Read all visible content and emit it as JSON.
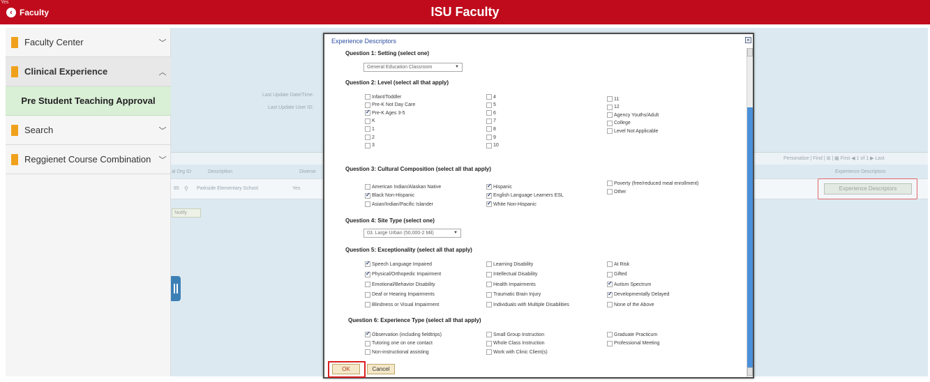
{
  "header": {
    "tag": "Yes",
    "back_label": "Faculty",
    "title": "ISU Faculty",
    "color": "#c00b1c"
  },
  "sidebar": {
    "items": [
      {
        "label": "Faculty Center",
        "chevron": "chevron-down-icon"
      },
      {
        "label": "Clinical Experience",
        "chevron": "chevron-up-icon"
      },
      {
        "label": "Pre Student Teaching Approval"
      },
      {
        "label": "Search",
        "chevron": "chevron-down-icon"
      },
      {
        "label": "Reggienet Course Combination",
        "chevron": "chevron-down-icon"
      }
    ]
  },
  "background": {
    "last_update_datetime_label": "Last Update Date/Time:",
    "last_update_user_label": "Last Update User ID:",
    "grid_toolbar": "Personalize | Find | ⊞ | ▦     First ◀ 1 of 1 ▶ Last",
    "columns": [
      "al Org ID",
      "Description",
      "Diverse",
      "Experience Descriptors"
    ],
    "row": {
      "org_id": "85",
      "description": "Parkside Elementary School",
      "diverse": "Yes"
    },
    "exp_desc_button": "Experience Descriptors",
    "notify_button": "Notify"
  },
  "modal": {
    "title": "Experience Descriptors",
    "q1": {
      "heading": "Question 1: Setting (select one)",
      "selected": "General Education Classroom"
    },
    "q2": {
      "heading": "Question 2: Level (select all that apply)",
      "col1": [
        {
          "label": "Infant/Toddler",
          "checked": false
        },
        {
          "label": "Pre-K Not Day Care",
          "checked": false
        },
        {
          "label": "Pre-K Ages 3-5",
          "checked": true
        },
        {
          "label": "K",
          "checked": false
        },
        {
          "label": "1",
          "checked": false
        },
        {
          "label": "2",
          "checked": false
        },
        {
          "label": "3",
          "checked": false
        }
      ],
      "col2": [
        {
          "label": "4",
          "checked": false
        },
        {
          "label": "5",
          "checked": false
        },
        {
          "label": "6",
          "checked": false
        },
        {
          "label": "7",
          "checked": false
        },
        {
          "label": "8",
          "checked": false
        },
        {
          "label": "9",
          "checked": false
        },
        {
          "label": "10",
          "checked": false
        }
      ],
      "col3": [
        {
          "label": "11",
          "checked": false
        },
        {
          "label": "12",
          "checked": false
        },
        {
          "label": "Agency Youths/Adult",
          "checked": false
        },
        {
          "label": "College",
          "checked": false
        },
        {
          "label": "Level Not Applicable",
          "checked": false
        }
      ]
    },
    "q3": {
      "heading": "Question 3: Cultural Composition (select all that apply)",
      "col1": [
        {
          "label": "American Indian/Alaskan Native",
          "checked": false
        },
        {
          "label": "Black Non-Hispanic",
          "checked": true
        },
        {
          "label": "Asian/Indian/Pacific Islander",
          "checked": false
        }
      ],
      "col2": [
        {
          "label": "Hispanic",
          "checked": true
        },
        {
          "label": "English Language Learners ESL",
          "checked": true
        },
        {
          "label": "White Non-Hispanic",
          "checked": true
        }
      ],
      "col3": [
        {
          "label": "Poverty (free/reduced meal enrollment)",
          "checked": false
        },
        {
          "label": "Other",
          "checked": false
        }
      ]
    },
    "q4": {
      "heading": "Question 4: Site Type (select one)",
      "selected": "03. Large Urban (50,000-2 Mil)"
    },
    "q5": {
      "heading": "Question 5: Exceptionality (select all that apply)",
      "col1": [
        {
          "label": "Speech Language Impaired",
          "checked": true
        },
        {
          "label": "Physical/Orthopedic Impairment",
          "checked": true
        },
        {
          "label": "Emotional/Behavior Disability",
          "checked": false
        },
        {
          "label": "Deaf or Hearing Impairments",
          "checked": false
        },
        {
          "label": "Blindness or Visual Impairment",
          "checked": false
        }
      ],
      "col2": [
        {
          "label": "Learning Disability",
          "checked": false
        },
        {
          "label": "Intellectual Disability",
          "checked": false
        },
        {
          "label": "Health Impairments",
          "checked": false
        },
        {
          "label": "Traumatic Brain Injury",
          "checked": false
        },
        {
          "label": "Individuals with Multiple Disabilities",
          "checked": false
        }
      ],
      "col3": [
        {
          "label": "At Risk",
          "checked": false
        },
        {
          "label": "Gifted",
          "checked": false
        },
        {
          "label": "Autism Spectrum",
          "checked": true
        },
        {
          "label": "Developmentally Delayed",
          "checked": true
        },
        {
          "label": "None of the Above",
          "checked": false
        }
      ]
    },
    "q6": {
      "heading": "Question 6: Experience Type (select all that apply)",
      "col1": [
        {
          "label": "Observation (including fieldtrips)",
          "checked": true
        },
        {
          "label": "Tutoring one on one contact",
          "checked": false
        },
        {
          "label": "Non-instructional assisting",
          "checked": false
        }
      ],
      "col2": [
        {
          "label": "Small Group Instruction",
          "checked": false
        },
        {
          "label": "Whole Class Instruction",
          "checked": false
        },
        {
          "label": "Work with Clinic Client(s)",
          "checked": false
        }
      ],
      "col3": [
        {
          "label": "Graduate Practicum",
          "checked": false
        },
        {
          "label": "Professional Meeting",
          "checked": false
        }
      ]
    },
    "ok_label": "OK",
    "cancel_label": "Cancel"
  }
}
